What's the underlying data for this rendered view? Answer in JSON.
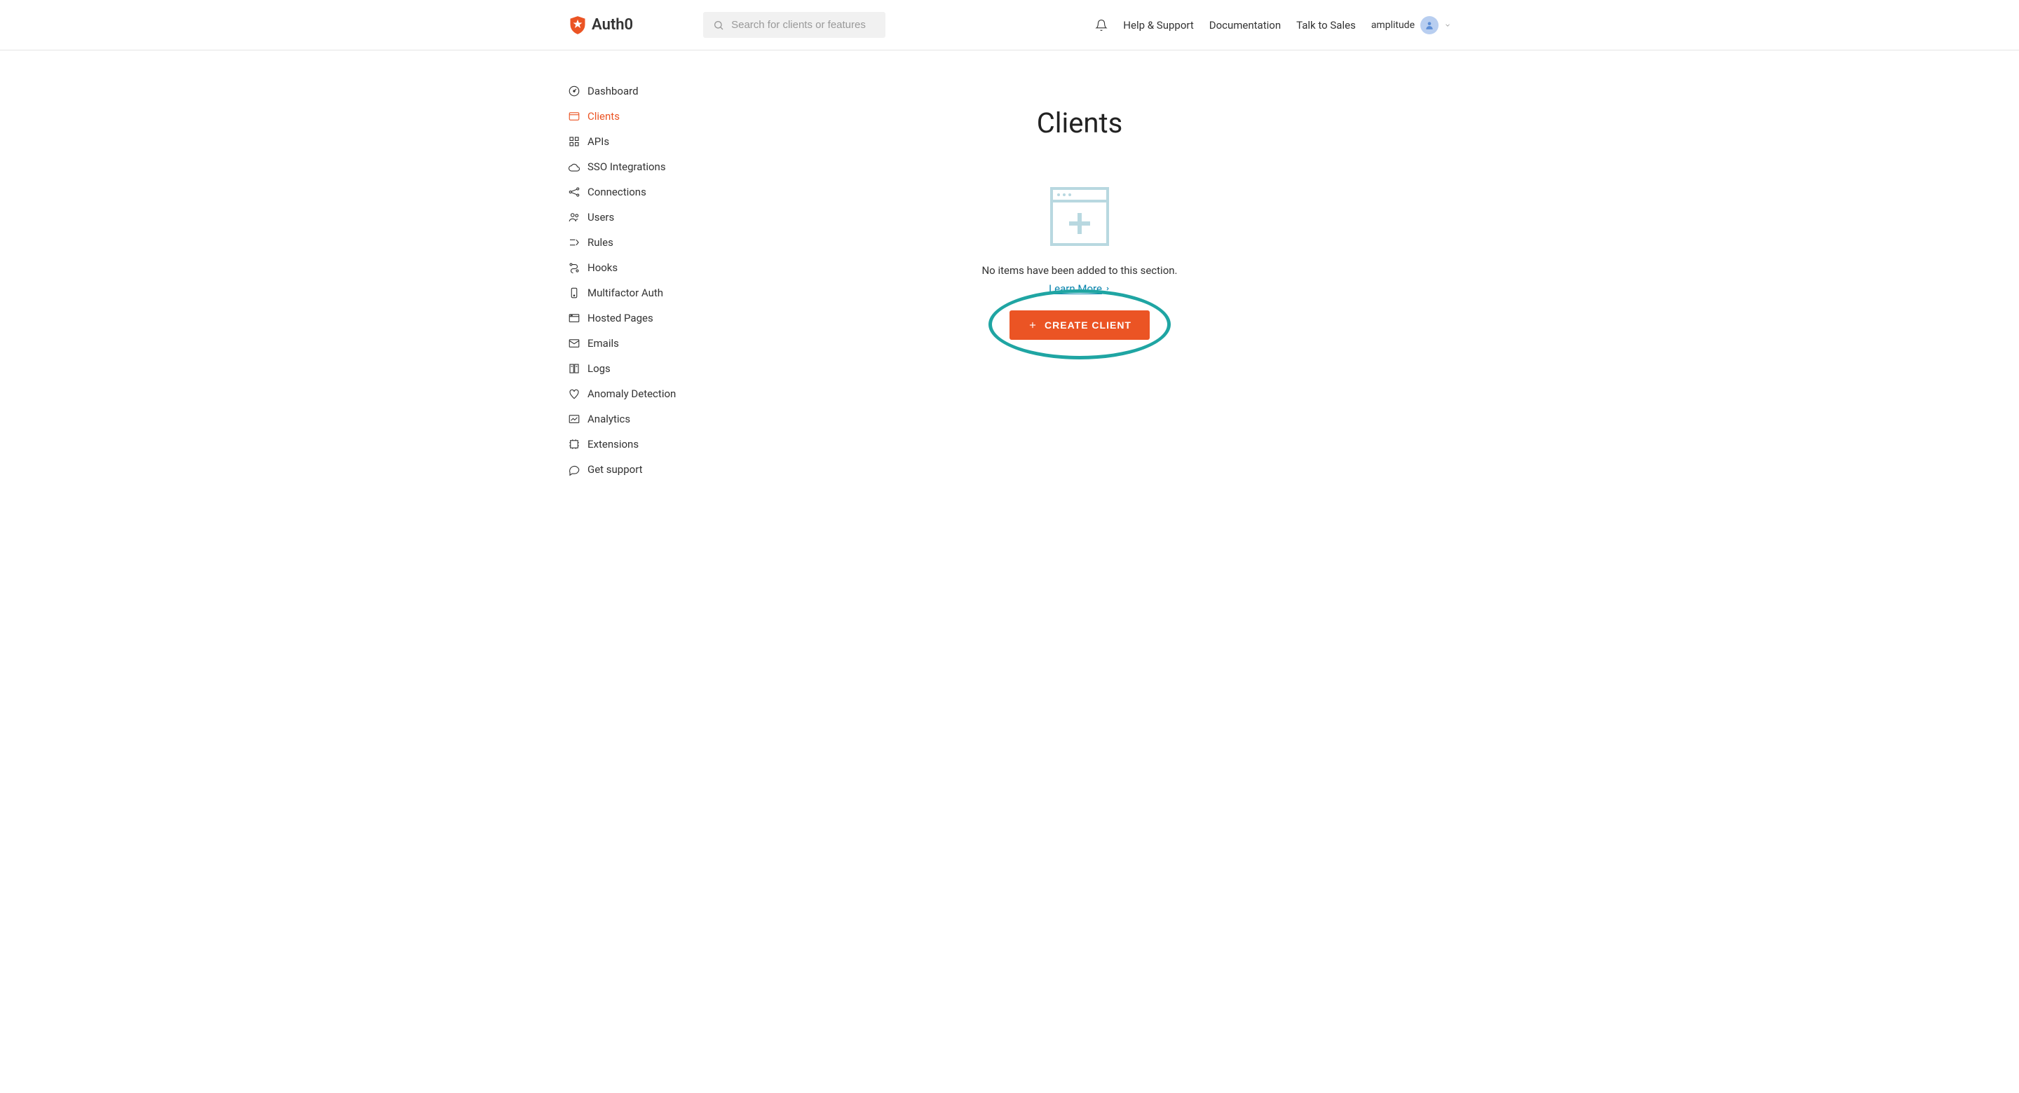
{
  "brand": {
    "name": "Auth0"
  },
  "search": {
    "placeholder": "Search for clients or features"
  },
  "nav": {
    "help": "Help & Support",
    "docs": "Documentation",
    "sales": "Talk to Sales",
    "tenant": "amplitude"
  },
  "sidebar": {
    "items": [
      {
        "label": "Dashboard",
        "icon": "dashboard"
      },
      {
        "label": "Clients",
        "icon": "clients",
        "active": true
      },
      {
        "label": "APIs",
        "icon": "apis"
      },
      {
        "label": "SSO Integrations",
        "icon": "sso"
      },
      {
        "label": "Connections",
        "icon": "connections"
      },
      {
        "label": "Users",
        "icon": "users"
      },
      {
        "label": "Rules",
        "icon": "rules"
      },
      {
        "label": "Hooks",
        "icon": "hooks"
      },
      {
        "label": "Multifactor Auth",
        "icon": "mfa"
      },
      {
        "label": "Hosted Pages",
        "icon": "hosted"
      },
      {
        "label": "Emails",
        "icon": "emails"
      },
      {
        "label": "Logs",
        "icon": "logs"
      },
      {
        "label": "Anomaly Detection",
        "icon": "anomaly"
      },
      {
        "label": "Analytics",
        "icon": "analytics"
      },
      {
        "label": "Extensions",
        "icon": "extensions"
      },
      {
        "label": "Get support",
        "icon": "support"
      }
    ]
  },
  "page": {
    "title": "Clients",
    "empty_text": "No items have been added to this section.",
    "learn_more": "Learn More",
    "create_button": "CREATE CLIENT"
  },
  "colors": {
    "accent": "#eb5424",
    "link": "#0a84ae",
    "highlight": "#1fa5a3"
  }
}
